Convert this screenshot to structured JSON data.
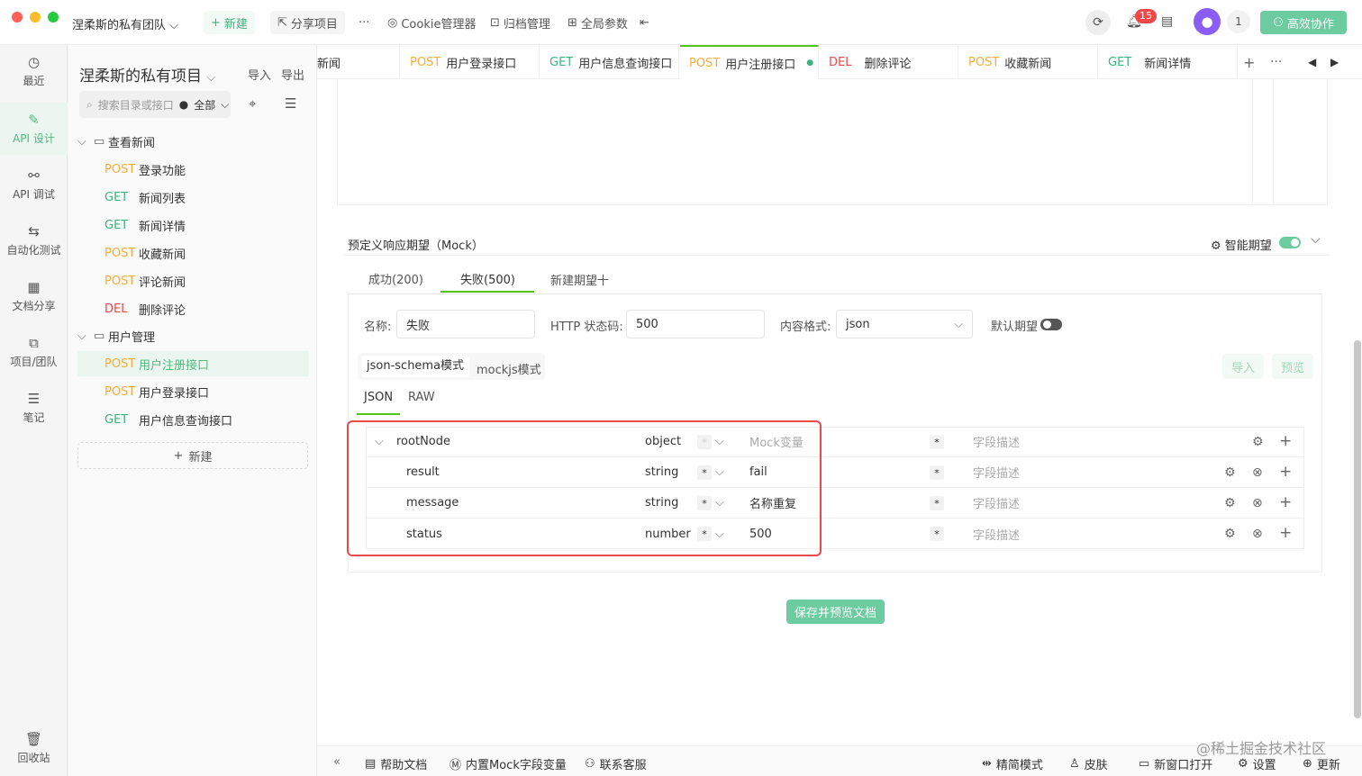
{
  "topbar": {
    "team_name": "涅柔斯的私有团队",
    "new_label": "新建",
    "share_label": "分享项目",
    "more": "···",
    "cookie_label": "Cookie管理器",
    "archive_label": "归档管理",
    "global_params_label": "全局参数",
    "notif_count": "15",
    "user_count": "1",
    "collab_label": "高效协作"
  },
  "leftnav": {
    "items": [
      {
        "label": "最近",
        "icon": "clock-icon"
      },
      {
        "label": "API 设计",
        "icon": "edit-icon"
      },
      {
        "label": "API 调试",
        "icon": "debug-icon"
      },
      {
        "label": "自动化测试",
        "icon": "flow-icon"
      },
      {
        "label": "文档分享",
        "icon": "doc-icon"
      },
      {
        "label": "项目/团队",
        "icon": "layers-icon"
      },
      {
        "label": "笔记",
        "icon": "note-icon"
      }
    ],
    "trash_label": "回收站"
  },
  "tree": {
    "project_title": "涅柔斯的私有项目",
    "import_label": "导入",
    "export_label": "导出",
    "search_placeholder": "搜索目录或接口",
    "filter_label": "全部",
    "folder1": "查看新闻",
    "folder2": "用户管理",
    "items1": [
      {
        "method": "POST",
        "name": "登录功能"
      },
      {
        "method": "GET",
        "name": "新闻列表"
      },
      {
        "method": "GET",
        "name": "新闻详情"
      },
      {
        "method": "POST",
        "name": "收藏新闻"
      },
      {
        "method": "POST",
        "name": "评论新闻"
      },
      {
        "method": "DEL",
        "name": "删除评论"
      }
    ],
    "items2": [
      {
        "method": "POST",
        "name": "用户注册接口"
      },
      {
        "method": "POST",
        "name": "用户登录接口"
      },
      {
        "method": "GET",
        "name": "用户信息查询接口"
      }
    ],
    "new_label": "新建"
  },
  "tabs": [
    {
      "method": "",
      "name": "新闻"
    },
    {
      "method": "POST",
      "name": "用户登录接口"
    },
    {
      "method": "GET",
      "name": "用户信息查询接口"
    },
    {
      "method": "POST",
      "name": "用户注册接口"
    },
    {
      "method": "DEL",
      "name": "删除评论"
    },
    {
      "method": "POST",
      "name": "收藏新闻"
    },
    {
      "method": "GET",
      "name": "新闻详情"
    }
  ],
  "mock": {
    "section_title": "预定义响应期望（Mock）",
    "smart_label": "智能期望",
    "subtabs": [
      "成功(200)",
      "失败(500)",
      "新建期望十"
    ],
    "name_label": "名称:",
    "name_value": "失败",
    "http_label": "HTTP 状态码:",
    "http_value": "500",
    "format_label": "内容格式:",
    "format_value": "json",
    "default_label": "默认期望",
    "mode_tabs": [
      "json-schema模式",
      "mockjs模式"
    ],
    "import_label": "导入",
    "preview_label": "预览",
    "view_tabs": [
      "JSON",
      "RAW"
    ],
    "rows": [
      {
        "name": "rootNode",
        "type": "object",
        "mock": "Mock变量",
        "desc": "字段描述"
      },
      {
        "name": "result",
        "type": "string",
        "mock": "fail",
        "desc": "字段描述"
      },
      {
        "name": "message",
        "type": "string",
        "mock": "名称重复",
        "desc": "字段描述"
      },
      {
        "name": "status",
        "type": "number",
        "mock": "500",
        "desc": "字段描述"
      }
    ],
    "star": "*",
    "save_label": "保存并预览文档"
  },
  "bottom": {
    "help": "帮助文档",
    "mock_vars": "内置Mock字段变量",
    "support": "联系客服",
    "simple_mode": "精简模式",
    "skin": "皮肤",
    "new_window": "新窗口打开",
    "settings": "设置",
    "update": "更新",
    "watermark": "@稀土掘金技术社区"
  },
  "colors": {
    "accent": "#52c41a",
    "primary_button": "#6ccca0",
    "highlight_border": "#e94a4a",
    "post": "#f7ad3b",
    "get": "#3fb27f",
    "del": "#e94a4a"
  }
}
